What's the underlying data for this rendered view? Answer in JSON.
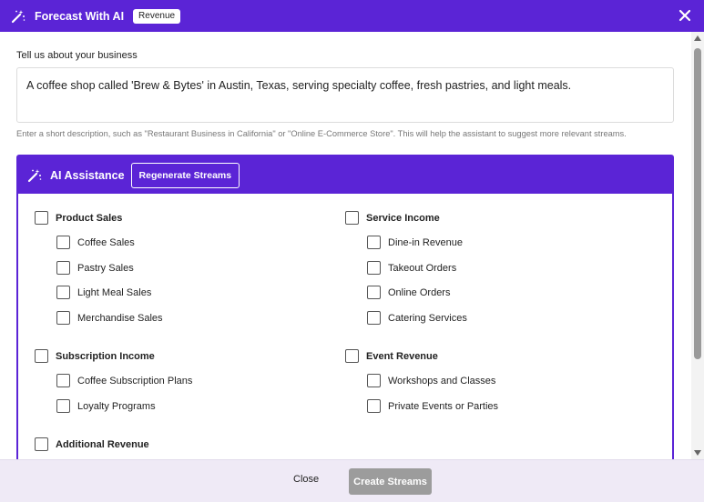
{
  "header": {
    "title": "Forecast With AI",
    "badge": "Revenue"
  },
  "business": {
    "label": "Tell us about your business",
    "description": "A coffee shop called 'Brew & Bytes' in Austin, Texas, serving specialty coffee, fresh pastries, and light meals.",
    "hint": "Enter a short description, such as \"Restaurant Business in California\" or \"Online E-Commerce Store\". This will help the assistant to suggest more relevant streams."
  },
  "ai": {
    "title": "AI Assistance",
    "regenerate_label": "Regenerate Streams"
  },
  "streams": {
    "product_sales": {
      "label": "Product Sales",
      "items": [
        "Coffee Sales",
        "Pastry Sales",
        "Light Meal Sales",
        "Merchandise Sales"
      ]
    },
    "service_income": {
      "label": "Service Income",
      "items": [
        "Dine-in Revenue",
        "Takeout Orders",
        "Online Orders",
        "Catering Services"
      ]
    },
    "subscription_income": {
      "label": "Subscription Income",
      "items": [
        "Coffee Subscription Plans",
        "Loyalty Programs"
      ]
    },
    "event_revenue": {
      "label": "Event Revenue",
      "items": [
        "Workshops and Classes",
        "Private Events or Parties"
      ]
    },
    "additional_revenue": {
      "label": "Additional Revenue",
      "items": []
    }
  },
  "footer": {
    "close_label": "Close",
    "create_label": "Create Streams"
  },
  "colors": {
    "accent": "#5b24d6",
    "footer_bg": "#efeaf6",
    "disabled_button": "#9c9c9c"
  },
  "icons": {
    "header": "magic-wand-icon",
    "close": "close-icon",
    "ai": "magic-wand-icon"
  }
}
